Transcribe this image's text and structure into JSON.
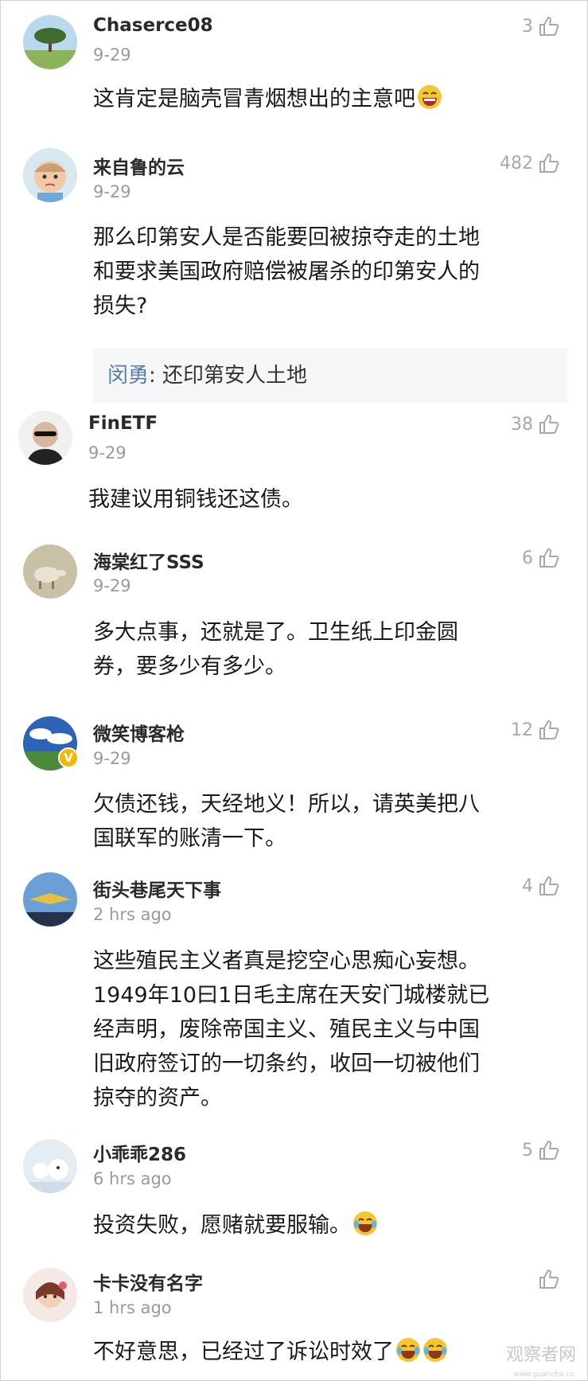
{
  "comments": [
    {
      "user": "Chaserce08",
      "time": "9-29",
      "likes": "3",
      "text": "这肯定是脑壳冒青烟想出的主意吧"
    },
    {
      "user": "来自鲁的云",
      "time": "9-29",
      "likes": "482",
      "text_lines": [
        "那么印第安人是否能要回被掠夺走的土地",
        "和要求美国政府赔偿被屠杀的印第安人的",
        "损失?"
      ],
      "reply": {
        "user": "闵勇",
        "sep": ": ",
        "text": "还印第安人土地"
      }
    },
    {
      "user": "FinETF",
      "time": "9-29",
      "likes": "38",
      "text": "我建议用铜钱还这债。"
    },
    {
      "user": "海棠红了SSS",
      "time": "9-29",
      "likes": "6",
      "text_lines": [
        "多大点事，还就是了。卫生纸上印金圆",
        "券，要多少有多少。"
      ]
    },
    {
      "user": "微笑博客枪",
      "time": "9-29",
      "likes": "12",
      "badge": "V",
      "text_lines": [
        "欠债还钱，天经地义！所以，请英美把八",
        "国联军的账清一下。"
      ]
    },
    {
      "user": "街头巷尾天下事",
      "time": "2 hrs ago",
      "likes": "4",
      "text_lines": [
        "这些殖民主义者真是挖空心思痴心妄想。",
        "1949年10曰1日毛主席在天安门城楼就已",
        "经声明，废除帝国主义、殖民主义与中国",
        "旧政府签订的一切条约，收回一切被他们",
        "掠夺的资产。"
      ]
    },
    {
      "user": "小乖乖286",
      "time": "6 hrs ago",
      "likes": "5",
      "text": "投资失败，愿赌就要服输。"
    },
    {
      "user": "卡卡没有名字",
      "time": "1 hrs ago",
      "likes": "",
      "text": "不好意思，已经过了诉讼时效了"
    }
  ],
  "watermark": "观察者网",
  "watermark_sub": "www.guancha.cn",
  "colors": {
    "username": "#2a2a2a",
    "time": "#9a9a9a",
    "like": "#a8a8a8",
    "reply_user": "#5b7ba8",
    "reply_bg": "#f5f6f8"
  }
}
